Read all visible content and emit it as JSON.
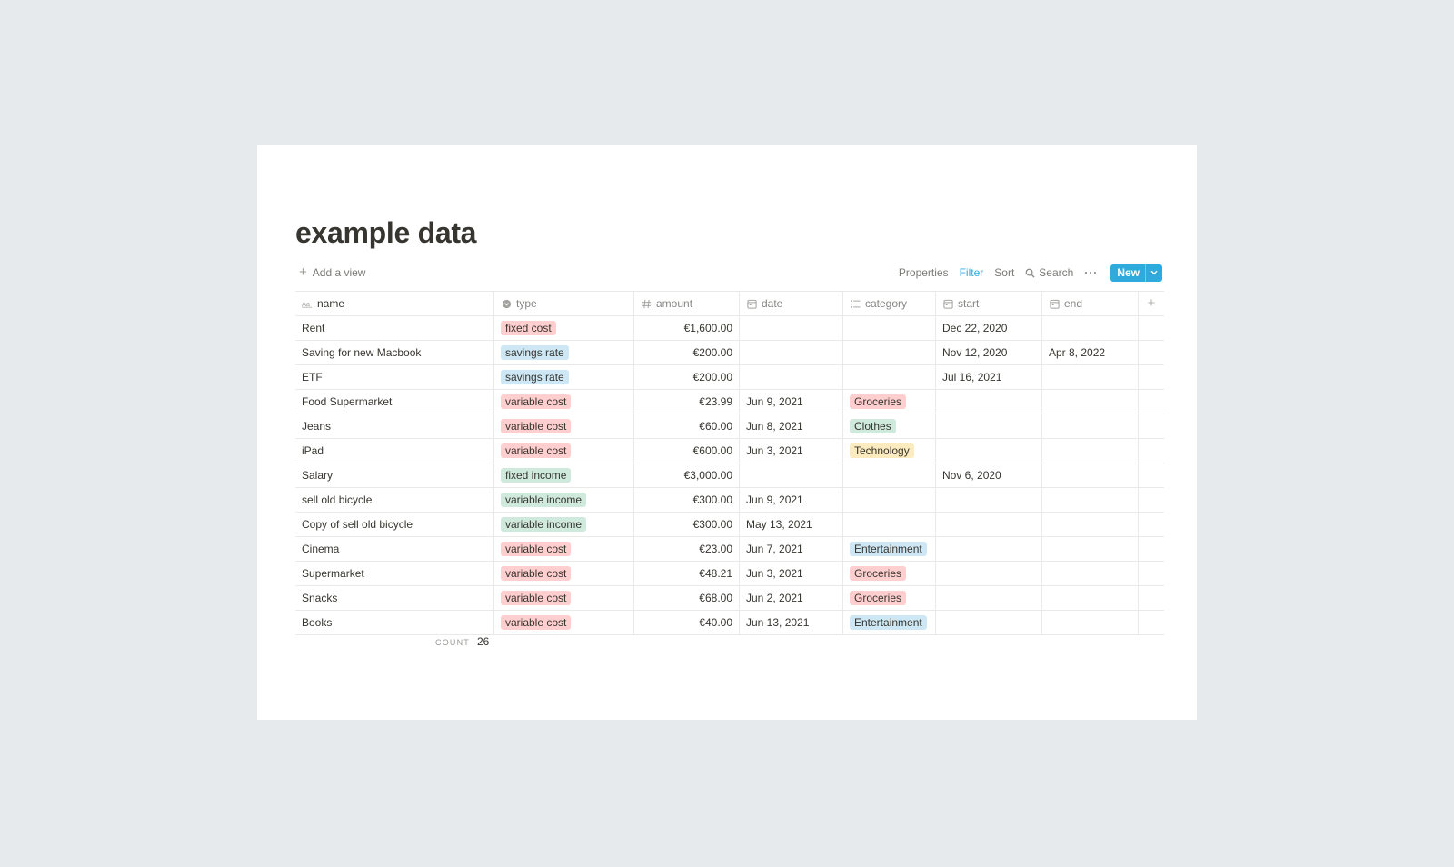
{
  "page": {
    "title": "example data"
  },
  "toolbar": {
    "add_view": "Add a view",
    "properties": "Properties",
    "filter": "Filter",
    "sort": "Sort",
    "search": "Search",
    "more": "···",
    "new": "New",
    "accent": "#2eaadc"
  },
  "columns": [
    "name",
    "type",
    "amount",
    "date",
    "category",
    "start",
    "end"
  ],
  "tag_colors": {
    "fixed cost": "#ffcfcf",
    "variable cost": "#ffcfcf",
    "savings rate": "#cde7f5",
    "fixed income": "#cfe9dc",
    "variable income": "#cfe9dc",
    "Groceries": "#ffcfcf",
    "Clothes": "#cfe9dc",
    "Technology": "#fcebbf",
    "Entertainment": "#cde7f5"
  },
  "rows": [
    {
      "name": "Rent",
      "type": "fixed cost",
      "type_color": "red",
      "amount": "€1,600.00",
      "date": "",
      "category": "",
      "category_color": "",
      "start": "Dec 22, 2020",
      "end": ""
    },
    {
      "name": "Saving for new Macbook",
      "type": "savings rate",
      "type_color": "blue",
      "amount": "€200.00",
      "date": "",
      "category": "",
      "category_color": "",
      "start": "Nov 12, 2020",
      "end": "Apr 8, 2022"
    },
    {
      "name": "ETF",
      "type": "savings rate",
      "type_color": "blue",
      "amount": "€200.00",
      "date": "",
      "category": "",
      "category_color": "",
      "start": "Jul 16, 2021",
      "end": ""
    },
    {
      "name": "Food Supermarket",
      "type": "variable cost",
      "type_color": "red",
      "amount": "€23.99",
      "date": "Jun 9, 2021",
      "category": "Groceries",
      "category_color": "red",
      "start": "",
      "end": ""
    },
    {
      "name": "Jeans",
      "type": "variable cost",
      "type_color": "red",
      "amount": "€60.00",
      "date": "Jun 8, 2021",
      "category": "Clothes",
      "category_color": "green",
      "start": "",
      "end": ""
    },
    {
      "name": "iPad",
      "type": "variable cost",
      "type_color": "red",
      "amount": "€600.00",
      "date": "Jun 3, 2021",
      "category": "Technology",
      "category_color": "yellow",
      "start": "",
      "end": ""
    },
    {
      "name": "Salary",
      "type": "fixed income",
      "type_color": "green",
      "amount": "€3,000.00",
      "date": "",
      "category": "",
      "category_color": "",
      "start": "Nov 6, 2020",
      "end": ""
    },
    {
      "name": "sell old bicycle",
      "type": "variable income",
      "type_color": "green",
      "amount": "€300.00",
      "date": "Jun 9, 2021",
      "category": "",
      "category_color": "",
      "start": "",
      "end": ""
    },
    {
      "name": "Copy of sell old bicycle",
      "type": "variable income",
      "type_color": "green",
      "amount": "€300.00",
      "date": "May 13, 2021",
      "category": "",
      "category_color": "",
      "start": "",
      "end": ""
    },
    {
      "name": "Cinema",
      "type": "variable cost",
      "type_color": "red",
      "amount": "€23.00",
      "date": "Jun 7, 2021",
      "category": "Entertainment",
      "category_color": "blue",
      "start": "",
      "end": ""
    },
    {
      "name": "Supermarket",
      "type": "variable cost",
      "type_color": "red",
      "amount": "€48.21",
      "date": "Jun 3, 2021",
      "category": "Groceries",
      "category_color": "red",
      "start": "",
      "end": ""
    },
    {
      "name": "Snacks",
      "type": "variable cost",
      "type_color": "red",
      "amount": "€68.00",
      "date": "Jun 2, 2021",
      "category": "Groceries",
      "category_color": "red",
      "start": "",
      "end": ""
    },
    {
      "name": "Books",
      "type": "variable cost",
      "type_color": "red",
      "amount": "€40.00",
      "date": "Jun 13, 2021",
      "category": "Entertainment",
      "category_color": "blue",
      "start": "",
      "end": ""
    }
  ],
  "footer": {
    "count_label": "COUNT",
    "count_value": "26"
  }
}
